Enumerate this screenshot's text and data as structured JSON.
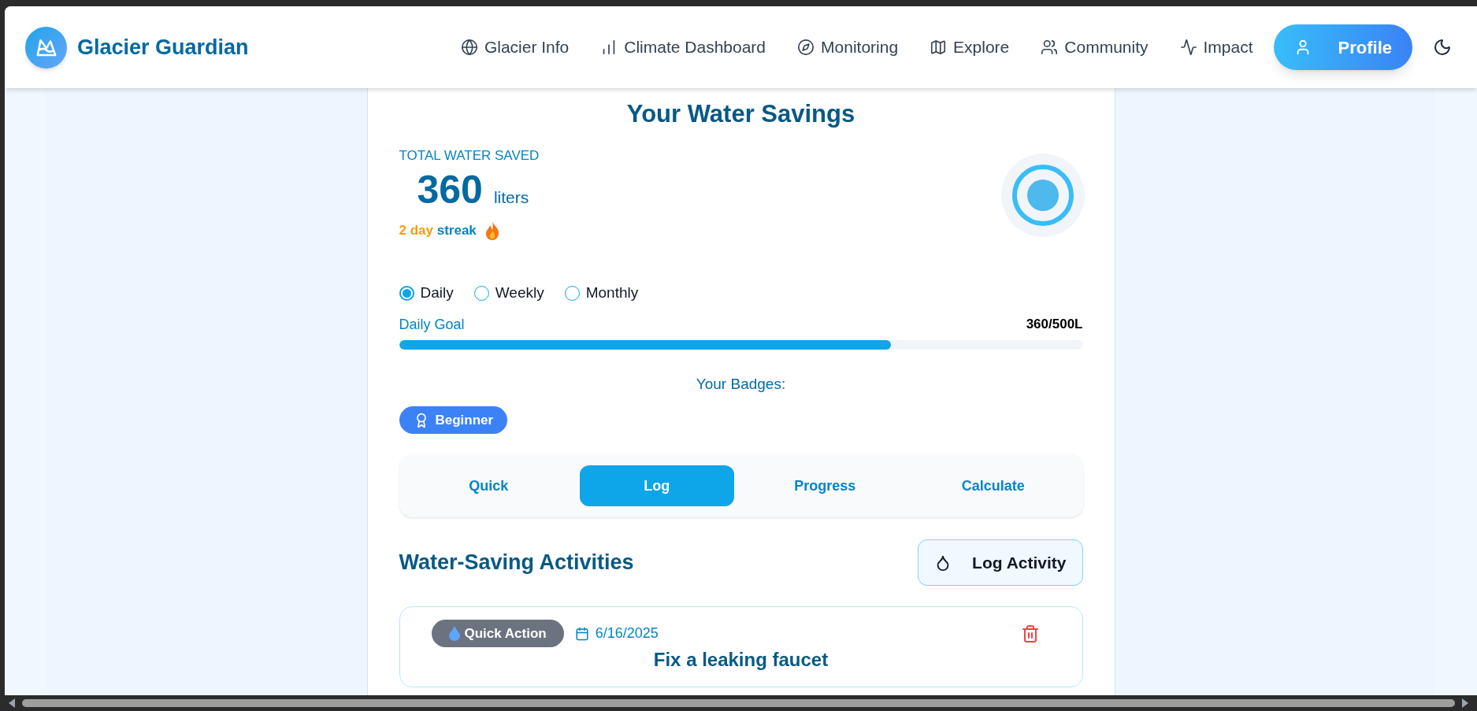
{
  "app": {
    "name": "Glacier Guardian"
  },
  "nav": [
    {
      "label": "Glacier Info"
    },
    {
      "label": "Climate Dashboard"
    },
    {
      "label": "Monitoring"
    },
    {
      "label": "Explore"
    },
    {
      "label": "Community"
    },
    {
      "label": "Impact"
    }
  ],
  "profile_button": {
    "label": "Profile"
  },
  "savings": {
    "title": "Your Water Savings",
    "total_label": "TOTAL WATER SAVED",
    "total": "360",
    "unit": "liters",
    "streak_count": "2 day",
    "streak_word": "streak"
  },
  "periods": [
    {
      "label": "Daily",
      "selected": true
    },
    {
      "label": "Weekly",
      "selected": false
    },
    {
      "label": "Monthly",
      "selected": false
    }
  ],
  "goal": {
    "label": "Daily Goal",
    "reading": "360/500L",
    "level": 0.72
  },
  "badges": {
    "title": "Your Badges:",
    "items": [
      {
        "label": "Beginner"
      }
    ]
  },
  "tabs": [
    {
      "label": "Quick",
      "selected": false
    },
    {
      "label": "Log",
      "selected": true
    },
    {
      "label": "Progress",
      "selected": false
    },
    {
      "label": "Calculate",
      "selected": false
    }
  ],
  "activities": {
    "title": "Water-Saving Activities",
    "log_button": "Log Activity",
    "items": [
      {
        "tag": "Quick Action",
        "date": "6/16/2025",
        "title": "Fix a leaking faucet"
      }
    ]
  }
}
